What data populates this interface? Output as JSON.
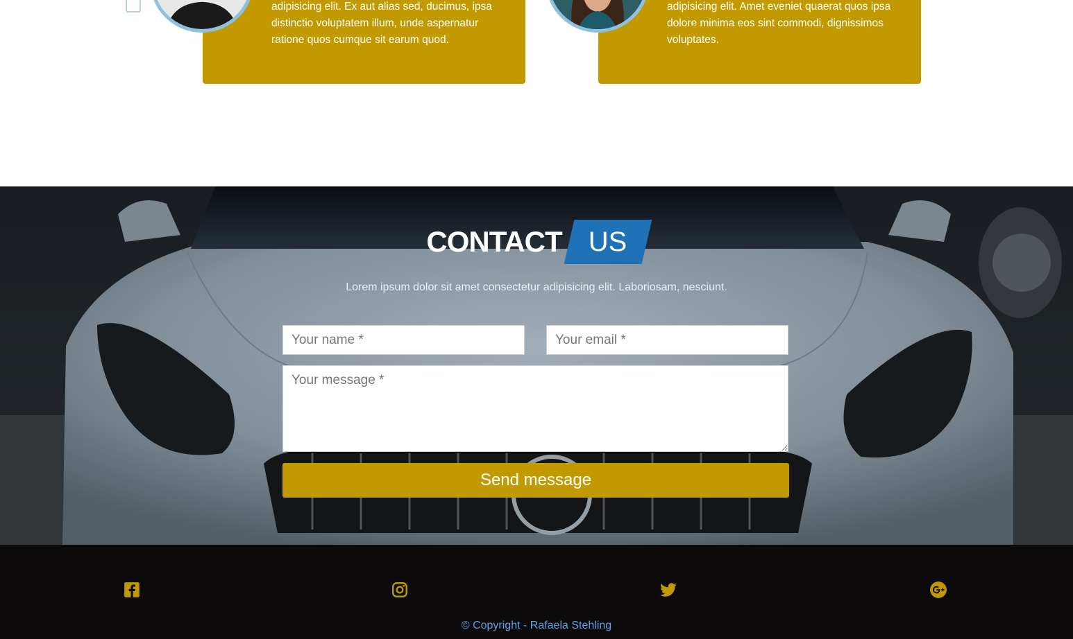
{
  "testimonials": {
    "cards": [
      {
        "text": "adipisicing elit. Ex aut alias sed, ducimus, ipsa distinctio voluptatem illum, unde aspernatur ratione quos cumque sit earum quod."
      },
      {
        "text": "adipisicing elit. Amet eveniet quaerat quos ipsa dolore minima eos sint commodi, dignissimos voluptates."
      }
    ]
  },
  "contact": {
    "title_main": "CONTACT",
    "title_highlight": "US",
    "subtitle": "Lorem ipsum dolor sit amet consectetur adipisicing elit. Laboriosam, nesciunt.",
    "name_placeholder": "Your name *",
    "email_placeholder": "Your email *",
    "message_placeholder": "Your message *",
    "send_label": "Send message"
  },
  "footer": {
    "social_icons": [
      "facebook-icon",
      "instagram-icon",
      "twitter-icon",
      "google-plus-icon"
    ],
    "copyright": "© Copyright - Rafaela Stehling"
  },
  "colors": {
    "accent_gold": "#c29a00",
    "title_blue": "#1f72b6",
    "footer_bg": "#0d0a0b",
    "copyright_blue": "#5aa3e6",
    "avatar_border": "#8ec1de"
  }
}
